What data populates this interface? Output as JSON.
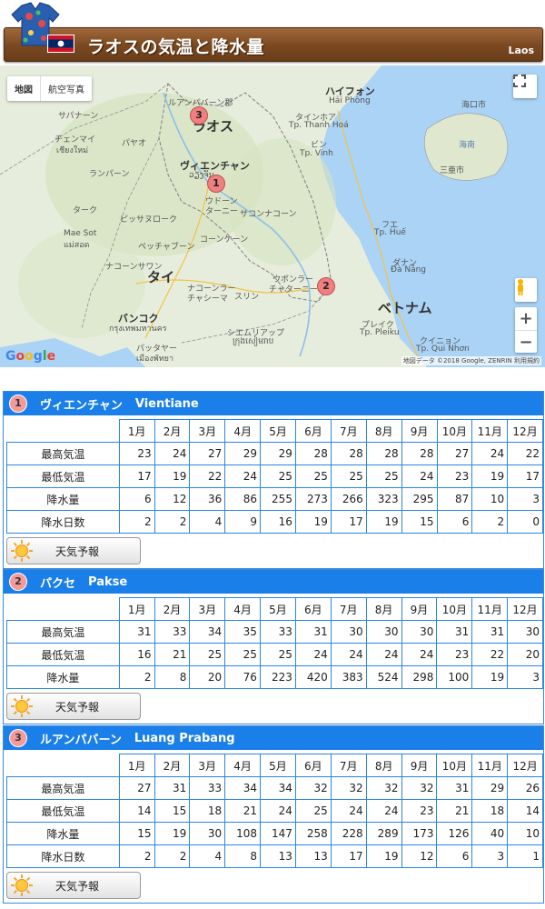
{
  "header": {
    "title": "ラオスの気温と降水量",
    "subtitle": "Laos",
    "colors": {
      "bar": "#7a4820",
      "flag_red": "#ce1126",
      "flag_blue": "#002868"
    }
  },
  "map": {
    "type_buttons": [
      "地図",
      "航空写真"
    ],
    "credit": "地図データ ©2018 Google, ZENRIN   利用規約",
    "google_logo": [
      "G",
      "o",
      "o",
      "g",
      "l",
      "e"
    ],
    "zoom_in": "+",
    "zoom_out": "−",
    "labels": {
      "luang_prabang_ja": "ルアンパバーン郡",
      "laos": "ラオス",
      "hanoi": "ハイフォン",
      "hai_phong": "Hải Phòng",
      "thanh_hoa_ja": "タインホア",
      "thanh_hoa": "Tp. Thanh Hoá",
      "vinh_ja": "ビン",
      "vinh": "Tp. Vinh",
      "haikou": "海口市",
      "hainan": "海南",
      "sanya": "三亜市",
      "chiang_mai": "チェンマイ",
      "chiang_mai_th": "เชียงใหม่",
      "sapannam": "サパナーン",
      "payao": "パヤオ",
      "lampang": "ランパーン",
      "vientiane_ja": "ヴィエンチャン",
      "vientiane_lo": "ວຽງຈັນ",
      "udon": "ウドーン",
      "udon2": "ターニー",
      "sakon": "サコンナコーン",
      "tak": "ターク",
      "phitsanulok": "ピッサヌローク",
      "mae_sot": "Mae Sot",
      "mae_sot_th": "แม่สอด",
      "khon_kaen": "コーンケーン",
      "phetchabun": "ペッチャブーン",
      "nakhon_sawan": "ナコーンサワン",
      "thai": "タイ",
      "nakhon_ratchasima": "ナコーンラー",
      "nakhon_ratchasima2": "チャシーマ",
      "surin": "スリン",
      "ubon": "ウボンラー",
      "ubon2": "チャターニー",
      "hue_ja": "フエ",
      "hue": "Tp. Huế",
      "da_nang_ja": "ダナン",
      "da_nang": "Đà Nẵng",
      "bangkok_ja": "バンコク",
      "bangkok_th": "กรุงเทพมหานคร",
      "pattaya": "パッタヤー",
      "pattaya_th": "เมืองพัทยา",
      "siem_reap": "シエムリアップ",
      "siem_reap_km": "ក្រុងសៀមរាប",
      "vietnam": "ベトナム",
      "pleiku_ja": "プレイク",
      "pleiku": "Tp. Pleiku",
      "quy_nhon_ja": "クイニョン",
      "quy_nhon": "Tp. Qui Nhơn"
    },
    "markers": [
      "1",
      "2",
      "3"
    ]
  },
  "months": [
    "1月",
    "2月",
    "3月",
    "4月",
    "5月",
    "6月",
    "7月",
    "8月",
    "9月",
    "10月",
    "11月",
    "12月"
  ],
  "forecast_label": "天気予報",
  "cities": [
    {
      "number": "1",
      "name_ja": "ヴィエンチャン",
      "name_en": "Vientiane",
      "rows": [
        {
          "label": "最高気温",
          "values": [
            23,
            24,
            27,
            29,
            29,
            28,
            28,
            28,
            28,
            27,
            24,
            22
          ]
        },
        {
          "label": "最低気温",
          "values": [
            17,
            19,
            22,
            24,
            25,
            25,
            25,
            25,
            24,
            23,
            19,
            17
          ]
        },
        {
          "label": "降水量",
          "values": [
            6,
            12,
            36,
            86,
            255,
            273,
            266,
            323,
            295,
            87,
            10,
            3
          ]
        },
        {
          "label": "降水日数",
          "values": [
            2,
            2,
            4,
            9,
            16,
            19,
            17,
            19,
            15,
            6,
            2,
            0
          ]
        }
      ]
    },
    {
      "number": "2",
      "name_ja": "パクセ",
      "name_en": "Pakse",
      "rows": [
        {
          "label": "最高気温",
          "values": [
            31,
            33,
            34,
            35,
            33,
            31,
            30,
            30,
            30,
            31,
            31,
            30
          ]
        },
        {
          "label": "最低気温",
          "values": [
            16,
            21,
            25,
            25,
            25,
            24,
            24,
            24,
            24,
            23,
            22,
            20
          ]
        },
        {
          "label": "降水量",
          "values": [
            2,
            8,
            20,
            76,
            223,
            420,
            383,
            524,
            298,
            100,
            19,
            3
          ]
        }
      ]
    },
    {
      "number": "3",
      "name_ja": "ルアンパバーン",
      "name_en": "Luang Prabang",
      "rows": [
        {
          "label": "最高気温",
          "values": [
            27,
            31,
            33,
            34,
            34,
            32,
            32,
            32,
            32,
            31,
            29,
            26
          ]
        },
        {
          "label": "最低気温",
          "values": [
            14,
            15,
            18,
            21,
            24,
            25,
            24,
            24,
            23,
            21,
            18,
            14
          ]
        },
        {
          "label": "降水量",
          "values": [
            15,
            19,
            30,
            108,
            147,
            258,
            228,
            289,
            173,
            126,
            40,
            10
          ]
        },
        {
          "label": "降水日数",
          "values": [
            2,
            2,
            4,
            8,
            13,
            13,
            17,
            19,
            12,
            6,
            3,
            1
          ]
        }
      ]
    }
  ]
}
